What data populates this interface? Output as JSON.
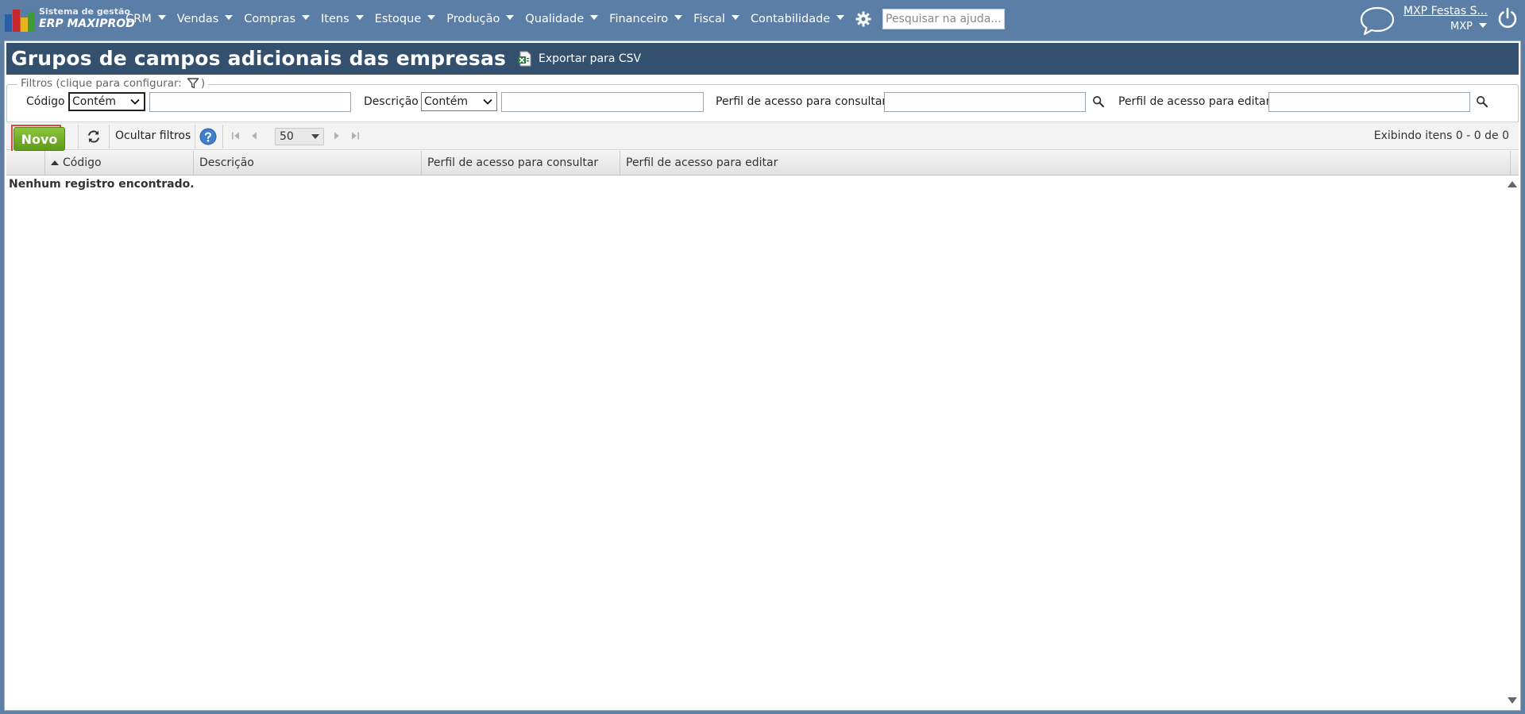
{
  "header": {
    "logo_line1": "Sistema de gestão",
    "logo_line2": "ERP MAXIPROD",
    "menu": [
      {
        "label": "CRM"
      },
      {
        "label": "Vendas"
      },
      {
        "label": "Compras"
      },
      {
        "label": "Itens"
      },
      {
        "label": "Estoque"
      },
      {
        "label": "Produção"
      },
      {
        "label": "Qualidade"
      },
      {
        "label": "Financeiro"
      },
      {
        "label": "Fiscal"
      },
      {
        "label": "Contabilidade"
      }
    ],
    "help_search_placeholder": "Pesquisar na ajuda...",
    "user_name": "MXP Festas S...",
    "company": "MXP",
    "icons": [
      "gear-icon",
      "question-icon",
      "chat-icon",
      "power-icon"
    ]
  },
  "page": {
    "title": "Grupos de campos adicionais das empresas",
    "export_label": "Exportar para CSV"
  },
  "filters": {
    "legend": "Filtros (clique para configurar:",
    "legend_close": ")",
    "codigo_label": "Código",
    "codigo_operator": "Contém",
    "codigo_value": "",
    "descricao_label": "Descrição",
    "descricao_operator": "Contém",
    "descricao_value": "",
    "perfil_consultar_label": "Perfil de acesso para consultar",
    "perfil_consultar_value": "",
    "perfil_editar_label": "Perfil de acesso para editar",
    "perfil_editar_value": ""
  },
  "toolbar": {
    "new_label": "Novo",
    "hide_filters_label": "Ocultar filtros",
    "page_size": "50",
    "items_info": "Exibindo itens 0 - 0 de 0"
  },
  "grid": {
    "columns": [
      "Código",
      "Descrição",
      "Perfil de acesso para consultar",
      "Perfil de acesso para editar"
    ],
    "sort_column": "Código",
    "sort_direction": "ascending",
    "empty_message": "Nenhum registro encontrado."
  },
  "colors": {
    "topbar": "#5a7ea6",
    "title_bar": "#34506f",
    "new_button": "#6fad22",
    "highlight": "#e0443f"
  }
}
